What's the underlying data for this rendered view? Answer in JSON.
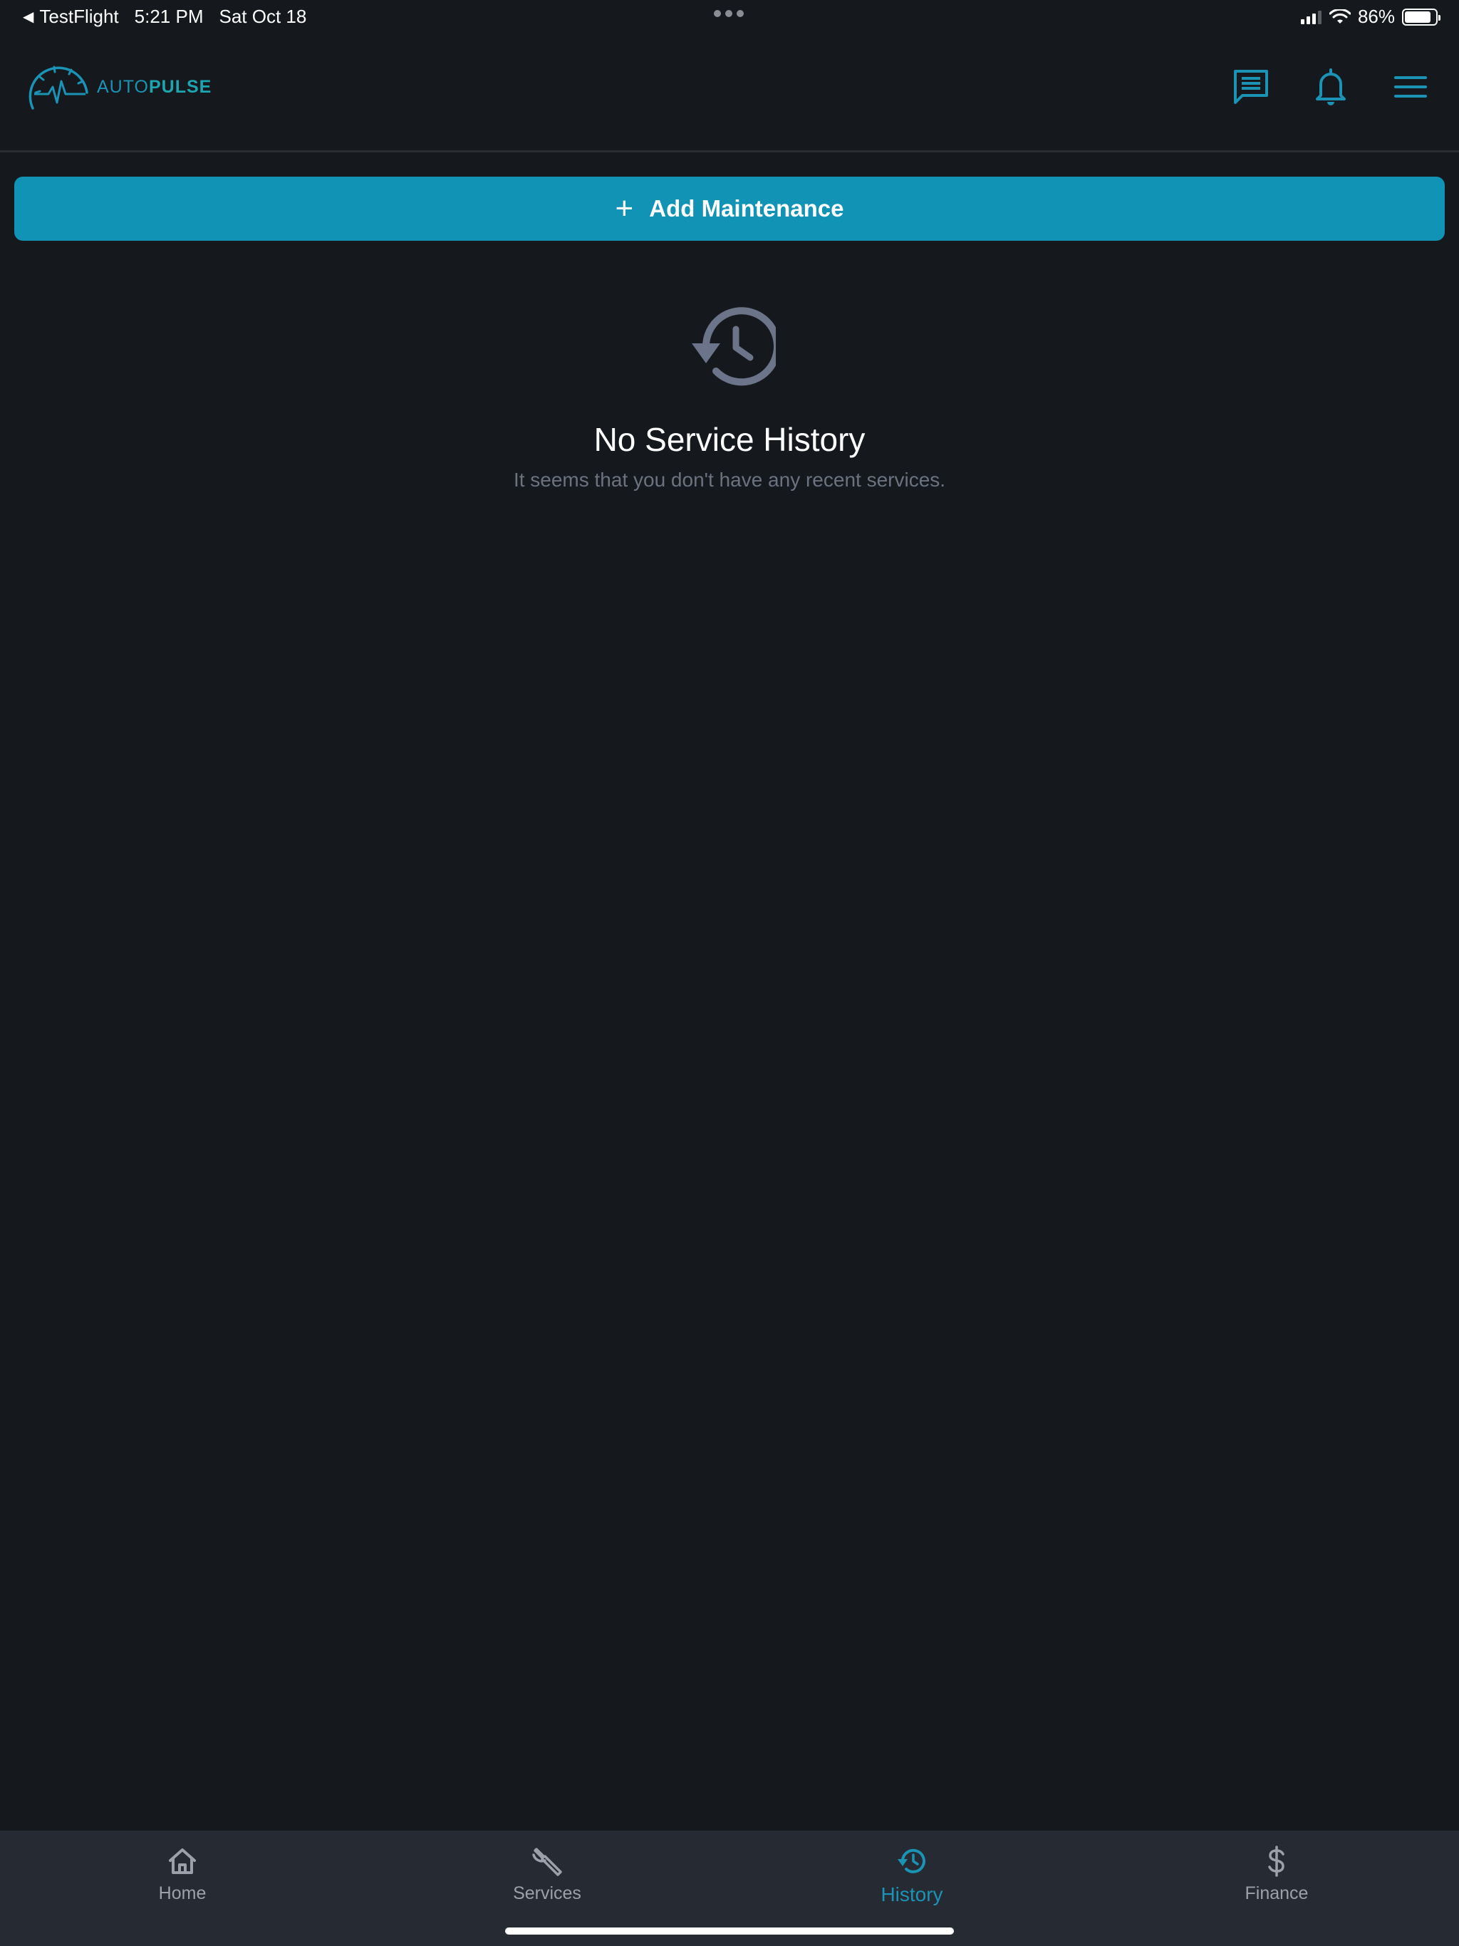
{
  "status_bar": {
    "back_app": "TestFlight",
    "time": "5:21 PM",
    "date": "Sat Oct 18",
    "battery": "86%"
  },
  "header": {
    "logo_text_light": "AUTO",
    "logo_text_bold": "PULSE",
    "icons": [
      "chat-icon",
      "bell-icon",
      "menu-icon"
    ]
  },
  "add_button": {
    "label": "Add Maintenance"
  },
  "empty_state": {
    "icon": "history-icon",
    "title": "No Service History",
    "subtitle": "It seems that you don't have any recent services."
  },
  "bottom_nav": {
    "items": [
      {
        "label": "Home",
        "icon": "home-icon"
      },
      {
        "label": "Services",
        "icon": "wrench-icon"
      },
      {
        "label": "History",
        "icon": "history-icon"
      },
      {
        "label": "Finance",
        "icon": "dollar-icon"
      }
    ],
    "active": "History"
  },
  "colors": {
    "background": "#15181c",
    "accent": "#1093b4",
    "nav_background": "#262b33",
    "muted_icon": "#6b7489"
  }
}
